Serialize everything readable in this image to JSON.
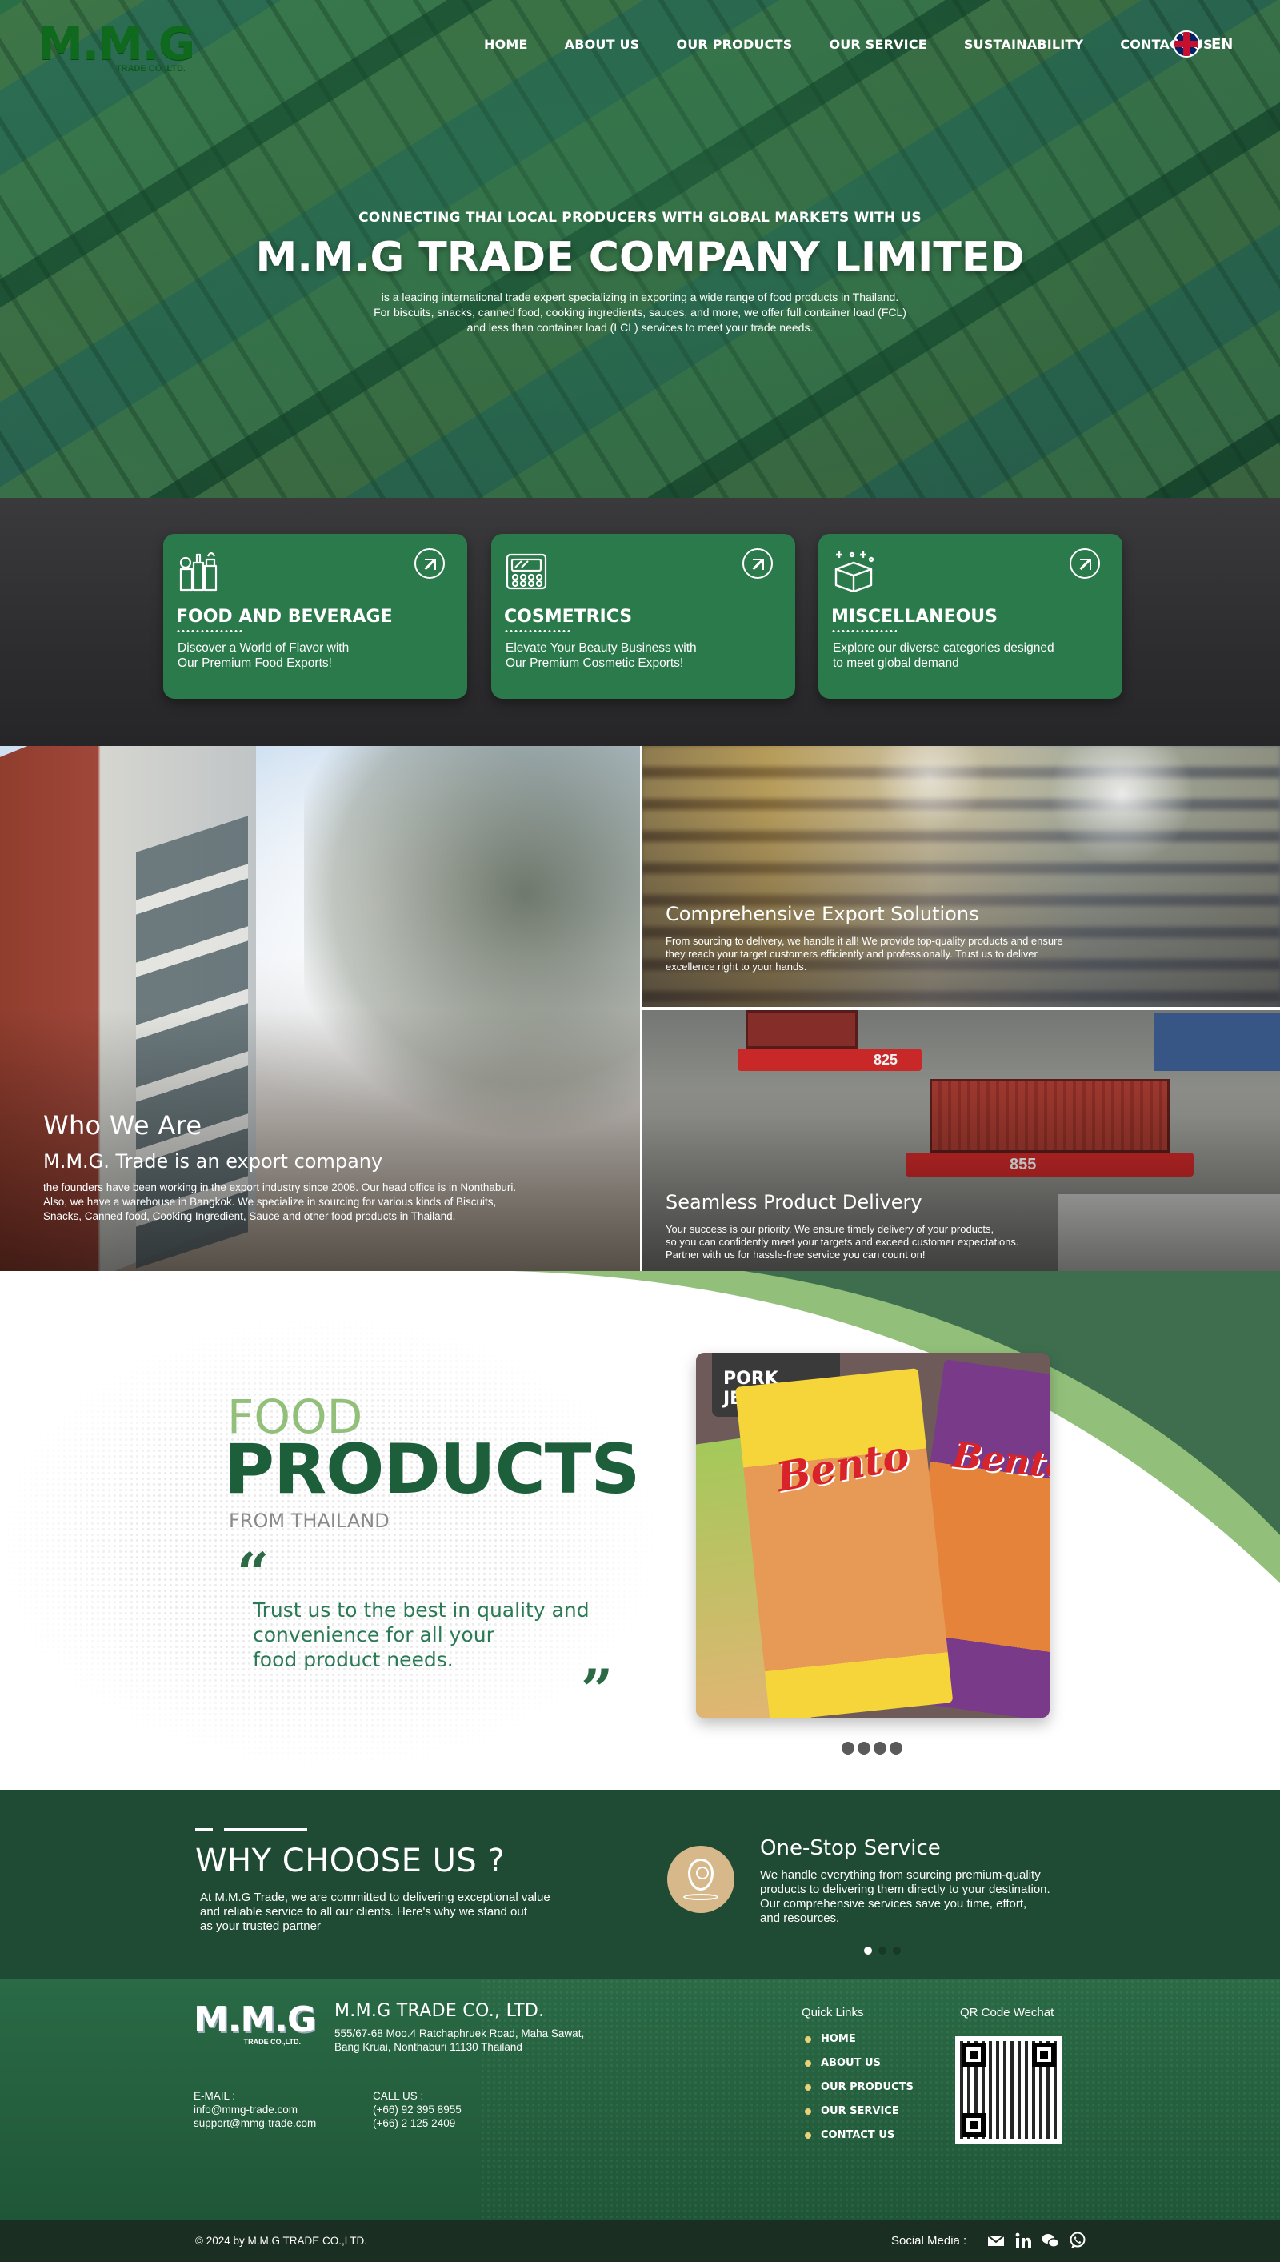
{
  "brand": {
    "logo_text": "M.M.G",
    "logo_sub": "TRADE CO.,LTD.",
    "primary_green": "#2b7a4b",
    "dark_green": "#1f4a33",
    "accent_light_green": "#92c07a"
  },
  "nav": {
    "items": [
      {
        "label": "HOME"
      },
      {
        "label": "ABOUT US"
      },
      {
        "label": "OUR PRODUCTS"
      },
      {
        "label": "OUR SERVICE"
      },
      {
        "label": "SUSTAINABILITY"
      },
      {
        "label": "CONTACT US"
      }
    ],
    "language": "EN",
    "flag_icon": "uk-flag-icon"
  },
  "hero": {
    "kicker": "CONNECTING THAI LOCAL PRODUCERS WITH GLOBAL MARKETS WITH US",
    "title": "M.M.G TRADE COMPANY LIMITED",
    "desc_line1": "is a leading international trade expert specializing in exporting a wide range of food products in Thailand.",
    "desc_line2": "For biscuits, snacks, canned food, cooking ingredients, sauces, and more, we offer full container load (FCL)",
    "desc_line3": "and less than container load (LCL) services to meet your trade needs."
  },
  "categories": [
    {
      "title": "FOOD AND BEVERAGE",
      "line1": "Discover a World of Flavor with",
      "line2": "Our Premium Food Exports!",
      "icon": "grocery-icon"
    },
    {
      "title": "COSMETRICS",
      "line1": "Elevate Your Beauty Business with",
      "line2": "Our Premium Cosmetic Exports!",
      "icon": "makeup-palette-icon"
    },
    {
      "title": "MISCELLANEOUS",
      "line1": "Explore our diverse categories designed",
      "line2": "to meet global demand",
      "icon": "gift-box-icon"
    }
  ],
  "who": {
    "title": "Who We Are",
    "subtitle": "M.M.G. Trade is an export company",
    "line1": "the founders have been working in the export industry since 2008. Our head office is in Nonthaburi.",
    "line2": "Also, we have a warehouse in Bangkok. We specialize in sourcing for various kinds of Biscuits,",
    "line3": "Snacks, Canned food, Cooking Ingredient, Sauce and other food products in Thailand."
  },
  "export": {
    "title": "Comprehensive Export Solutions",
    "line1": "From sourcing to delivery, we handle it all! We provide top-quality products and ensure",
    "line2": "they reach your target customers efficiently and professionally. Trust us to deliver",
    "line3": "excellence right to your hands."
  },
  "delivery": {
    "title": "Seamless Product Delivery",
    "line1": "Your success is our priority. We ensure timely delivery of your products,",
    "line2": "so you can confidently meet your targets and exceed customer expectations.",
    "line3": "Partner with us for hassle-free service you can count on!",
    "truck1_label": "825",
    "truck2_label": "855"
  },
  "food": {
    "kicker": "FOOD",
    "title": "PRODUCTS",
    "from": "FROM THAILAND",
    "open_quote": "“",
    "close_quote": "”",
    "quote_line1": "Trust us to the best in quality and",
    "quote_line2": "convenience for all your",
    "quote_line3": "food product needs.",
    "photo_brand": "Bento",
    "photo_jerky": "PORK JERKY",
    "slide_count": 4
  },
  "why": {
    "title": "WHY CHOOSE US ?",
    "line1": "At M.M.G Trade, we are committed to delivering exceptional value",
    "line2": "and reliable service to all our clients. Here's why we stand out",
    "line3": "as your trusted partner",
    "service_title": "One-Stop Service",
    "service_line1": "We handle everything from sourcing premium-quality",
    "service_line2": "products to delivering them directly to your destination.",
    "service_line3": "Our comprehensive services save you time, effort,",
    "service_line4": "and resources.",
    "badge_icon": "location-pin-icon",
    "badge_color": "#d6b88a"
  },
  "footer": {
    "company": "M.M.G TRADE CO., LTD.",
    "addr_line1": "555/67-68 Moo.4 Ratchaphruek Road, Maha Sawat,",
    "addr_line2": "Bang Kruai, Nonthaburi  11130 Thailand",
    "email_label": "E-MAIL :",
    "email1": "info@mmg-trade.com",
    "email2": "support@mmg-trade.com",
    "call_label": "CALL US :",
    "phone1": "(+66) 92 395 8955",
    "phone2": "(+66) 2 125 2409",
    "quick_links_title": "Quick Links",
    "quick_links": [
      "HOME",
      "ABOUT US",
      "OUR PRODUCTS",
      "OUR SERVICE",
      "CONTACT US"
    ],
    "qr_title": "QR Code Wechat"
  },
  "bottom": {
    "copyright": "© 2024 by M.M.G TRADE CO.,LTD.",
    "social_label": "Social Media :",
    "social_icons": [
      "mail-icon",
      "linkedin-icon",
      "wechat-icon",
      "whatsapp-icon"
    ]
  }
}
